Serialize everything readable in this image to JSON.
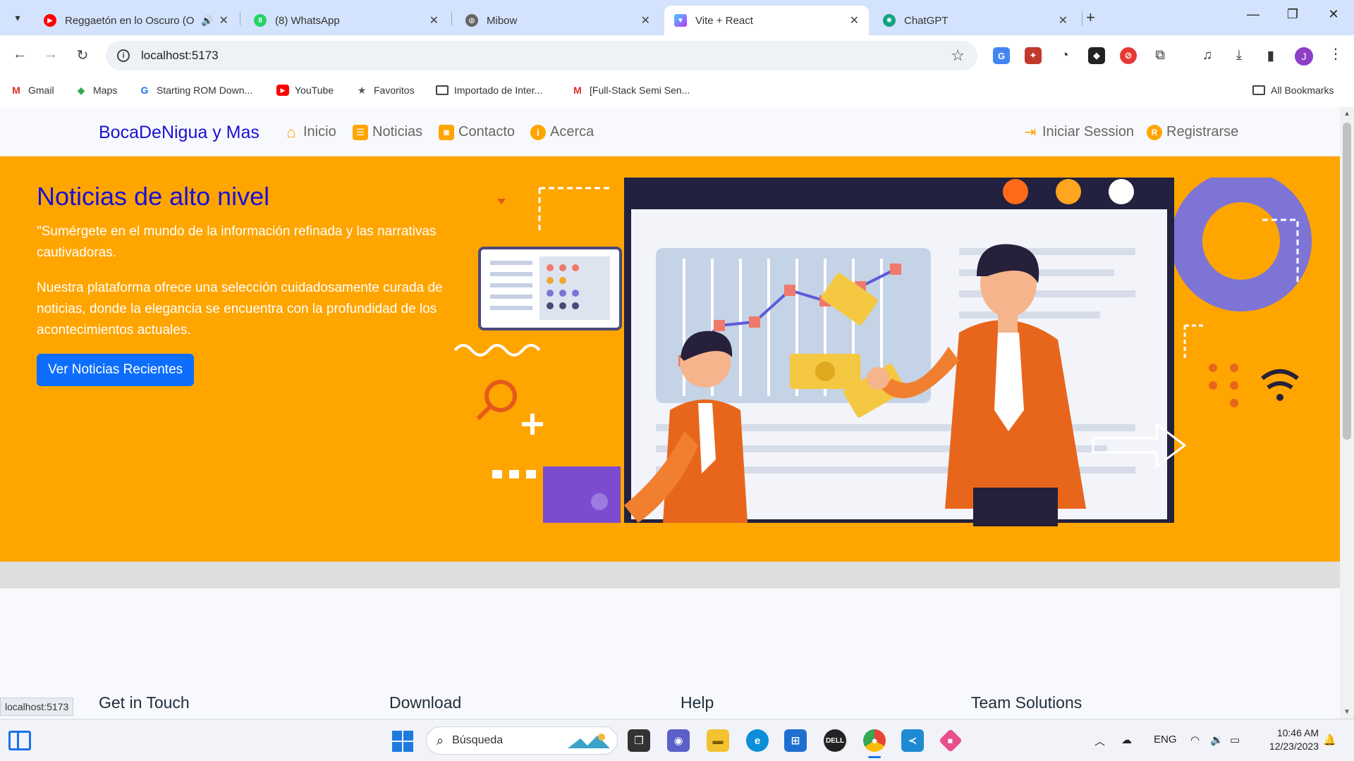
{
  "browser": {
    "tabs": [
      {
        "title": "Reggaetón en lo Oscuro (O",
        "favicon": "youtube-icon",
        "color": "#ff0000",
        "audio": true
      },
      {
        "title": "(8) WhatsApp",
        "favicon": "whatsapp-icon",
        "color": "#25d366",
        "badge": "8"
      },
      {
        "title": "Mibow",
        "favicon": "globe-icon",
        "color": "#555555"
      },
      {
        "title": "Vite + React",
        "favicon": "vite-icon",
        "color": "#9b59ff",
        "active": true
      },
      {
        "title": "ChatGPT",
        "favicon": "chatgpt-icon",
        "color": "#10a37f"
      }
    ],
    "address": "localhost:5173",
    "profile_initial": "J",
    "bookmarks": [
      {
        "label": "Gmail",
        "icon": "gmail-icon"
      },
      {
        "label": "Maps",
        "icon": "maps-icon"
      },
      {
        "label": "Starting ROM Down...",
        "icon": "g-icon"
      },
      {
        "label": "YouTube",
        "icon": "youtube-icon"
      },
      {
        "label": "Favoritos",
        "icon": "star-icon"
      },
      {
        "label": "Importado de Inter...",
        "icon": "folder-icon"
      },
      {
        "label": "[Full-Stack Semi Sen...",
        "icon": "gmail-icon"
      }
    ],
    "all_bookmarks": "All Bookmarks",
    "status_url": "localhost:5173"
  },
  "site": {
    "brand": "BocaDeNigua y Mas",
    "nav": [
      {
        "label": "Inicio",
        "icon": "home-icon"
      },
      {
        "label": "Noticias",
        "icon": "newspaper-icon"
      },
      {
        "label": "Contacto",
        "icon": "contact-card-icon"
      },
      {
        "label": "Acerca",
        "icon": "info-icon"
      }
    ],
    "auth": [
      {
        "label": "Iniciar Session",
        "icon": "sign-in-icon"
      },
      {
        "label": "Registrarse",
        "icon": "register-icon"
      }
    ],
    "hero": {
      "title": "Noticias de alto nivel",
      "p1": "\"Sumérgete en el mundo de la información refinada y las narrativas cautivadoras.",
      "p2": "Nuestra plataforma ofrece una selección cuidadosamente curada de noticias, donde la elegancia se encuentra con la profundidad de los acontecimientos actuales.",
      "cta": "Ver Noticias Recientes"
    },
    "footer_headings": [
      "Get in Touch",
      "Download",
      "Help",
      "Team Solutions"
    ],
    "colors": {
      "hero": "#ffa500",
      "brand": "#1a10d6",
      "cta": "#0d6efd"
    }
  },
  "taskbar": {
    "search_placeholder": "Búsqueda",
    "language": "ENG",
    "time": "10:46 AM",
    "date": "12/23/2023"
  }
}
